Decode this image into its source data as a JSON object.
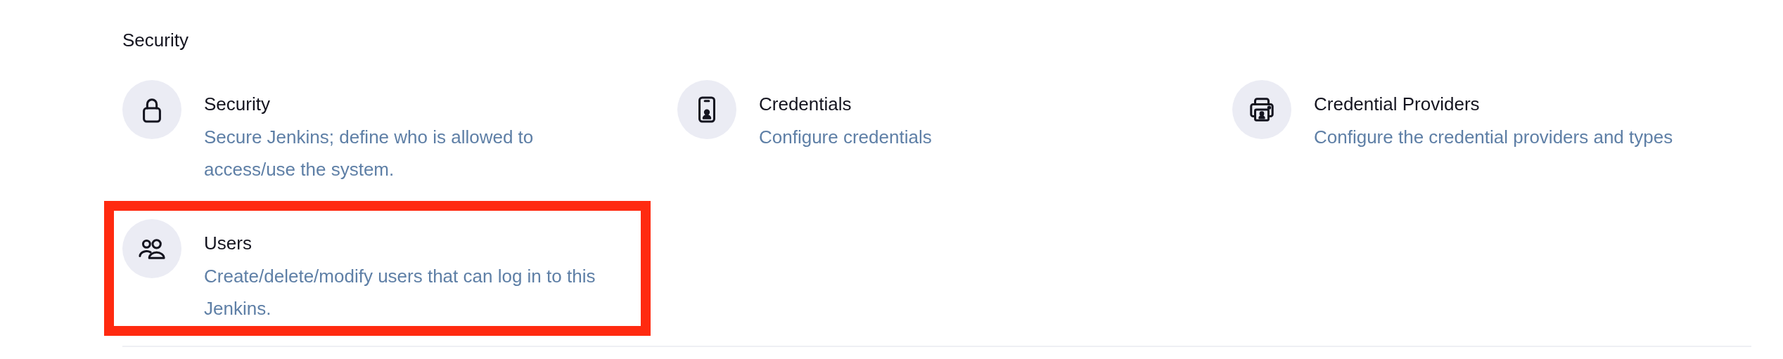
{
  "section": {
    "title": "Security"
  },
  "items": [
    {
      "title": "Security",
      "description": "Secure Jenkins; define who is allowed to access/use the system.",
      "highlighted": false
    },
    {
      "title": "Credentials",
      "description": "Configure credentials",
      "highlighted": false
    },
    {
      "title": "Credential Providers",
      "description": "Configure the credential providers and types",
      "highlighted": false
    },
    {
      "title": "Users",
      "description": "Create/delete/modify users that can log in to this Jenkins.",
      "highlighted": true
    }
  ]
}
